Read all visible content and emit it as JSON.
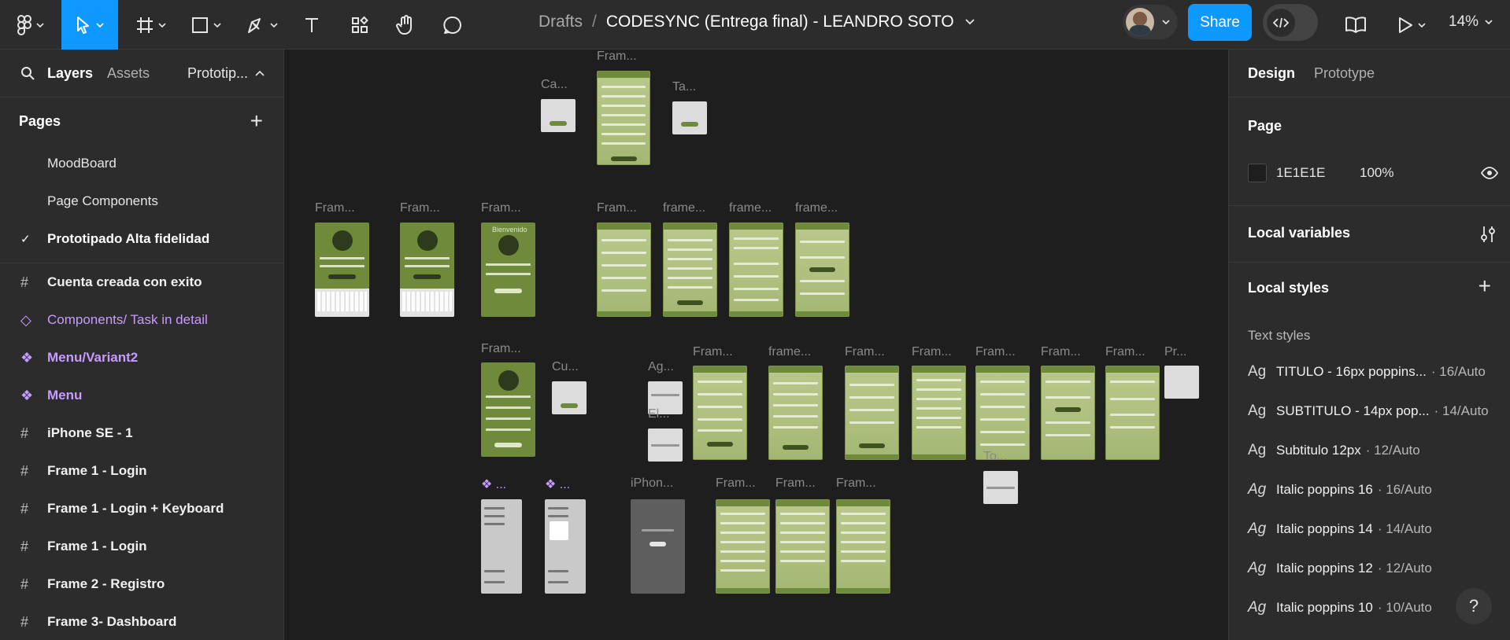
{
  "toolbar": {
    "breadcrumb_root": "Drafts",
    "breadcrumb_sep": "/",
    "file_name": "CODESYNC (Entrega final) - LEANDRO SOTO",
    "share_label": "Share",
    "zoom": "14%"
  },
  "left_panel": {
    "tabs": {
      "layers": "Layers",
      "assets": "Assets",
      "page_switch": "Prototip..."
    },
    "pages_title": "Pages",
    "pages": [
      "MoodBoard",
      "Page Components",
      "Prototipado Alta fidelidad"
    ],
    "layers": [
      "Cuenta creada con exito",
      "Components/ Task in detail",
      "Menu/Variant2",
      "Menu",
      "iPhone SE - 1",
      "Frame 1 - Login",
      "Frame 1 - Login + Keyboard",
      "Frame 1 - Login",
      "Frame 2 - Registro",
      "Frame 3- Dashboard"
    ]
  },
  "canvas": {
    "labels": {
      "l1": "Fram...",
      "l2": "Ca...",
      "l3": "Ta...",
      "l4": "Fram...",
      "l5": "Fram...",
      "l6": "Fram...",
      "l7": "Fram...",
      "l8": "frame...",
      "l9": "frame...",
      "l10": "frame...",
      "l11": "Fram...",
      "l12": "Cu...",
      "l13": "Ag...",
      "l14": "Fram...",
      "l15": "frame...",
      "l16": "Fram...",
      "l17": "Fram...",
      "l18": "Fram...",
      "l19": "Fram...",
      "l20": "Fram...",
      "l21": "Pr...",
      "l22": "El...",
      "l23": "❖ ...",
      "l24": "❖ ...",
      "l25": "iPhon...",
      "l26": "Fram...",
      "l27": "Fram...",
      "l28": "Fram...",
      "l29": "To..."
    },
    "frame_texts": {
      "bienvenido": "Bienvenido"
    }
  },
  "right_panel": {
    "tabs": {
      "design": "Design",
      "prototype": "Prototype"
    },
    "page_title": "Page",
    "page_color": "1E1E1E",
    "page_opacity": "100%",
    "local_variables": "Local variables",
    "local_styles": "Local styles",
    "text_styles_title": "Text styles",
    "text_styles": [
      {
        "glyph": "Ag",
        "name": "TITULO - 16px poppins...",
        "meta": "· 16/Auto",
        "italic": false
      },
      {
        "glyph": "Ag",
        "name": "SUBTITULO - 14px pop...",
        "meta": "· 14/Auto",
        "italic": false
      },
      {
        "glyph": "Ag",
        "name": "Subtitulo 12px",
        "meta": "· 12/Auto",
        "italic": false
      },
      {
        "glyph": "Ag",
        "name": "Italic poppins 16",
        "meta": "· 16/Auto",
        "italic": true
      },
      {
        "glyph": "Ag",
        "name": "Italic poppins 14",
        "meta": "· 14/Auto",
        "italic": true
      },
      {
        "glyph": "Ag",
        "name": "Italic poppins 12",
        "meta": "· 12/Auto",
        "italic": true
      },
      {
        "glyph": "Ag",
        "name": "Italic poppins 10",
        "meta": "· 10/Auto",
        "italic": true
      }
    ],
    "help": "?"
  },
  "colors": {
    "accent": "#0d99ff",
    "panel": "#2c2c2c",
    "canvas": "#1e1e1e",
    "component": "#c89bff"
  }
}
